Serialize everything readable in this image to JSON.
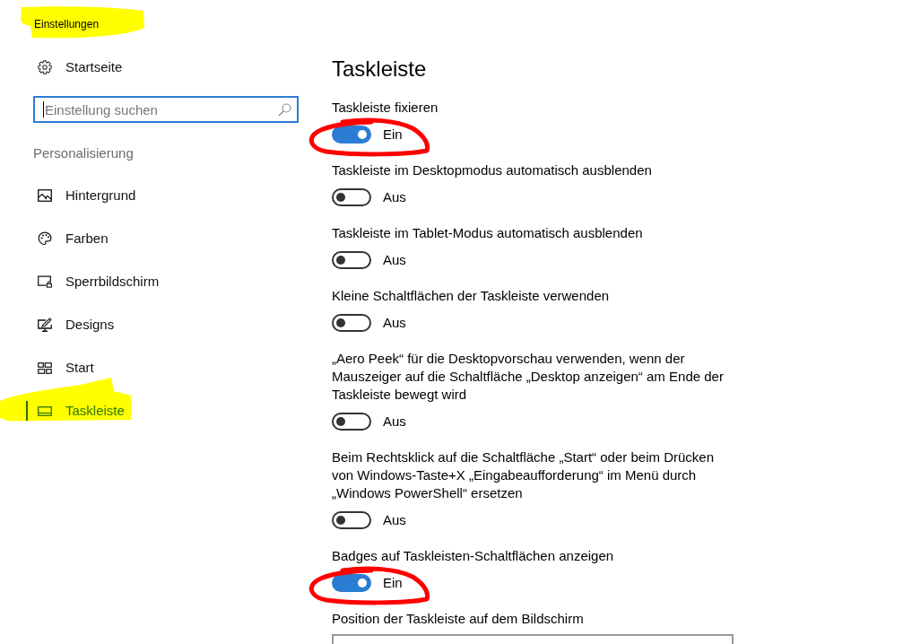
{
  "window": {
    "title": "Einstellungen",
    "highlighted": true
  },
  "sidebar": {
    "home": "Startseite",
    "search": {
      "placeholder": "Einstellung suchen",
      "focused": true
    },
    "section": "Personalisierung",
    "items": [
      {
        "label": "Hintergrund",
        "selected": false,
        "highlighted": false
      },
      {
        "label": "Farben",
        "selected": false,
        "highlighted": false
      },
      {
        "label": "Sperrbildschirm",
        "selected": false,
        "highlighted": false
      },
      {
        "label": "Designs",
        "selected": false,
        "highlighted": false
      },
      {
        "label": "Start",
        "selected": false,
        "highlighted": false
      },
      {
        "label": "Taskleiste",
        "selected": true,
        "highlighted": true
      }
    ]
  },
  "page": {
    "title": "Taskleiste",
    "settings": [
      {
        "kind": "toggle",
        "label": "Taskleiste fixieren",
        "on": true,
        "state_text": "Ein",
        "circled": true
      },
      {
        "kind": "toggle",
        "label": "Taskleiste im Desktopmodus automatisch ausblenden",
        "on": false,
        "state_text": "Aus",
        "circled": false
      },
      {
        "kind": "toggle",
        "label": "Taskleiste im Tablet-Modus automatisch ausblenden",
        "on": false,
        "state_text": "Aus",
        "circled": false
      },
      {
        "kind": "toggle",
        "label": "Kleine Schaltflächen der Taskleiste verwenden",
        "on": false,
        "state_text": "Aus",
        "circled": false
      },
      {
        "kind": "toggle",
        "label": "„Aero Peek“ für die Desktopvorschau verwenden, wenn der Mauszeiger auf die Schaltfläche „Desktop anzeigen“ am Ende der Taskleiste bewegt wird",
        "on": false,
        "state_text": "Aus",
        "circled": false
      },
      {
        "kind": "toggle",
        "label": "Beim Rechtsklick auf die Schaltfläche „Start“ oder beim Drücken von Windows-Taste+X „Eingabeaufforderung“ im Menü durch „Windows PowerShell“ ersetzen",
        "on": false,
        "state_text": "Aus",
        "circled": false
      },
      {
        "kind": "toggle",
        "label": "Badges auf Taskleisten-Schaltflächen anzeigen",
        "on": true,
        "state_text": "Ein",
        "circled": true
      },
      {
        "kind": "dropdown",
        "label": "Position der Taskleiste auf dem Bildschirm"
      }
    ]
  }
}
